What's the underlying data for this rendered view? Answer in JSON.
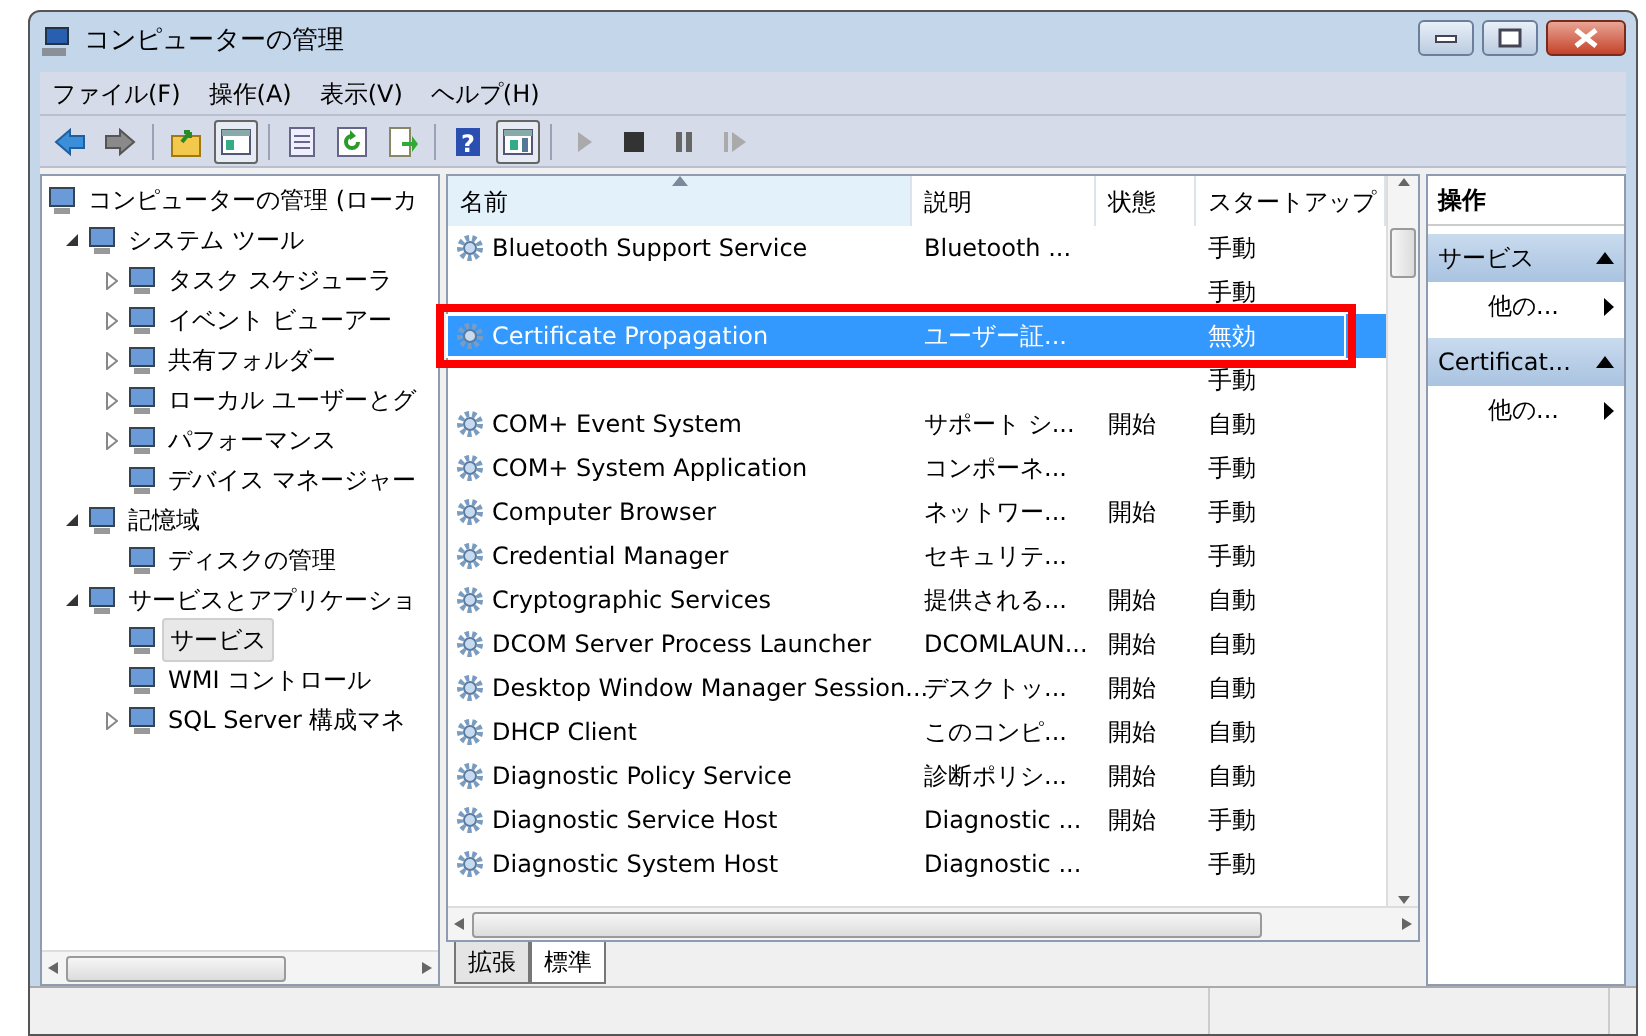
{
  "window": {
    "title": "コンピューターの管理"
  },
  "menu": [
    "ファイル(F)",
    "操作(A)",
    "表示(V)",
    "ヘルプ(H)"
  ],
  "toolbar": [
    {
      "kind": "back",
      "pressed": false
    },
    {
      "kind": "forward",
      "pressed": false
    },
    {
      "kind": "separator"
    },
    {
      "kind": "up",
      "pressed": false
    },
    {
      "kind": "console-tree",
      "pressed": true
    },
    {
      "kind": "separator"
    },
    {
      "kind": "properties",
      "pressed": false
    },
    {
      "kind": "refresh",
      "pressed": false
    },
    {
      "kind": "export",
      "pressed": false
    },
    {
      "kind": "separator"
    },
    {
      "kind": "help",
      "pressed": false,
      "label": "?"
    },
    {
      "kind": "action-pane",
      "pressed": true
    },
    {
      "kind": "separator"
    },
    {
      "kind": "play",
      "pressed": false
    },
    {
      "kind": "stop",
      "pressed": false
    },
    {
      "kind": "pause",
      "pressed": false
    },
    {
      "kind": "resume",
      "pressed": false
    }
  ],
  "tree": [
    {
      "label": "コンピューターの管理 (ローカ",
      "selected": false,
      "children": [
        {
          "label": "システム ツール",
          "expanded": true,
          "selected": false,
          "children": [
            {
              "label": "タスク スケジューラ",
              "expanded": false,
              "selected": false
            },
            {
              "label": "イベント ビューアー",
              "expanded": false,
              "selected": false
            },
            {
              "label": "共有フォルダー",
              "expanded": false,
              "selected": false
            },
            {
              "label": "ローカル ユーザーとグ",
              "expanded": false,
              "selected": false
            },
            {
              "label": "パフォーマンス",
              "expanded": false,
              "selected": false
            },
            {
              "label": "デバイス マネージャー",
              "selected": false
            }
          ]
        },
        {
          "label": "記憶域",
          "expanded": true,
          "selected": false,
          "children": [
            {
              "label": "ディスクの管理",
              "selected": false
            }
          ]
        },
        {
          "label": "サービスとアプリケーショ",
          "expanded": true,
          "selected": false,
          "children": [
            {
              "label": "サービス",
              "selected": true
            },
            {
              "label": "WMI コントロール",
              "selected": false
            },
            {
              "label": "SQL Server 構成マネ",
              "expanded": false,
              "selected": false
            }
          ]
        }
      ]
    }
  ],
  "table": {
    "columns": [
      {
        "label": "名前",
        "sorted": true
      },
      {
        "label": "説明",
        "sorted": false
      },
      {
        "label": "状態",
        "sorted": false
      },
      {
        "label": "スタートアップ",
        "sorted": false
      }
    ],
    "rows": [
      {
        "name": "Bluetooth Support Service",
        "description": "Bluetooth ...",
        "startup": "手動",
        "selected": false
      },
      {
        "startup": "手動",
        "selected": false
      },
      {
        "name": "Certificate Propagation",
        "description": "ユーザー証...",
        "startup": "無効",
        "selected": true,
        "highlighted": true
      },
      {
        "startup": "手動",
        "selected": false
      },
      {
        "name": "COM+ Event System",
        "description": "サポート シ...",
        "status": "開始",
        "startup": "自動",
        "selected": false
      },
      {
        "name": "COM+ System Application",
        "description": "コンポーネ...",
        "startup": "手動",
        "selected": false
      },
      {
        "name": "Computer Browser",
        "description": "ネットワー...",
        "status": "開始",
        "startup": "手動",
        "selected": false
      },
      {
        "name": "Credential Manager",
        "description": "セキュリテ...",
        "startup": "手動",
        "selected": false
      },
      {
        "name": "Cryptographic Services",
        "description": "提供される...",
        "status": "開始",
        "startup": "自動",
        "selected": false
      },
      {
        "name": "DCOM Server Process Launcher",
        "description": "DCOMLAUN...",
        "status": "開始",
        "startup": "自動",
        "selected": false
      },
      {
        "name": "Desktop Window Manager Session...",
        "description": "デスクトッ...",
        "status": "開始",
        "startup": "自動",
        "selected": false
      },
      {
        "name": "DHCP Client",
        "description": "このコンピ...",
        "status": "開始",
        "startup": "自動",
        "selected": false
      },
      {
        "name": "Diagnostic Policy Service",
        "description": "診断ポリシ...",
        "status": "開始",
        "startup": "自動",
        "selected": false
      },
      {
        "name": "Diagnostic Service Host",
        "description": "Diagnostic ...",
        "status": "開始",
        "startup": "手動",
        "selected": false
      },
      {
        "name": "Diagnostic System Host",
        "description": "Diagnostic ...",
        "startup": "手動",
        "selected": false
      }
    ]
  },
  "view_tabs": [
    {
      "label": "拡張",
      "selected": false
    },
    {
      "label": "標準",
      "selected": true
    }
  ],
  "actions": {
    "title": "操作",
    "sections": [
      {
        "title": "サービス",
        "items": [
          "他の..."
        ]
      },
      {
        "title": "Certificat...",
        "items": [
          "他の..."
        ]
      }
    ]
  }
}
